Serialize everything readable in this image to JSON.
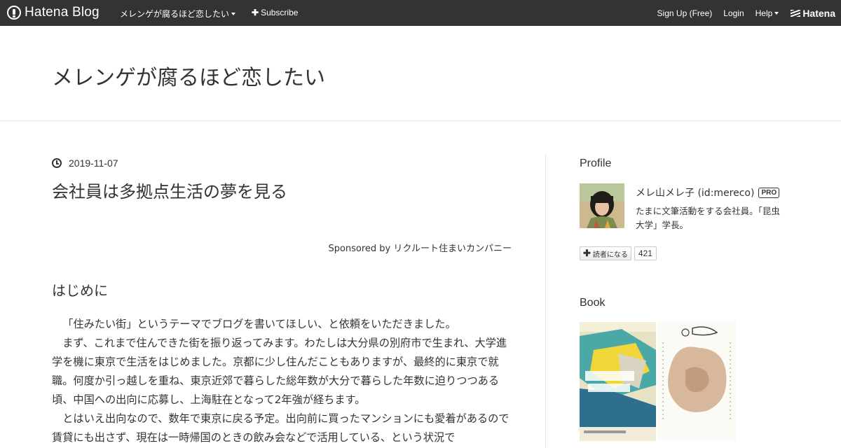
{
  "topbar": {
    "logo_text": "Hatena Blog",
    "blog_name": "メレンゲが腐るほど恋したい",
    "subscribe": "Subscribe",
    "signup": "Sign Up (Free)",
    "login": "Login",
    "help": "Help",
    "hatena": "Hatena"
  },
  "header": {
    "title": "メレンゲが腐るほど恋したい"
  },
  "entry": {
    "date": "2019-11-07",
    "title": "会社員は多拠点生活の夢を見る",
    "sponsored": "Sponsored by リクルート住まいカンパニー",
    "section_heading": "はじめに",
    "paragraphs": [
      "「住みたい街」というテーマでブログを書いてほしい、と依頼をいただきました。",
      "まず、これまで住んできた街を振り返ってみます。わたしは大分県の別府市で生まれ、大学進学を機に東京で生活をはじめました。京都に少し住んだこともありますが、最終的に東京で就職。何度か引っ越しを重ね、東京近郊で暮らした総年数が大分で暮らした年数に迫りつつある頃、中国への出向に応募し、上海駐在となって2年強が経ちます。",
      "とはいえ出向なので、数年で東京に戻る予定。出向前に買ったマンションにも愛着があるので賃貸にも出さず、現在は一時帰国のときの飲み会などで活用している、という状況で"
    ]
  },
  "sidebar": {
    "profile_title": "Profile",
    "profile_name": "メレ山メレ子 (id:mereco)",
    "pro_label": "PRO",
    "profile_desc": "たまに文筆活動をする会社員。「昆虫大学」学長。",
    "reader_button": "読者になる",
    "reader_count": "421",
    "book_title": "Book"
  },
  "colors": {
    "topbar_bg": "#333333",
    "text": "#333333",
    "divider": "#e5e5e5"
  },
  "icons": {
    "clock": "clock-icon",
    "plus": "plus-icon",
    "caret": "caret-down-icon"
  }
}
